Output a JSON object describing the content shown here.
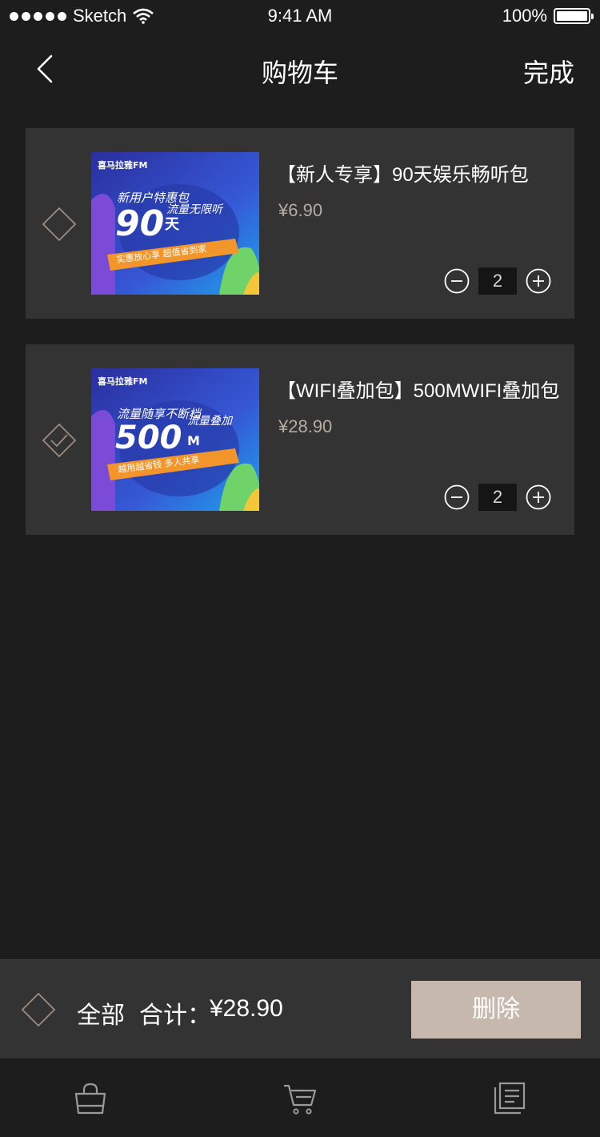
{
  "status_bar": {
    "carrier": "Sketch",
    "time": "9:41 AM",
    "battery": "100%"
  },
  "nav": {
    "title": "购物车",
    "done_label": "完成"
  },
  "items": [
    {
      "title": "【新人专享】90天娱乐畅听包",
      "price": "¥6.90",
      "quantity": "2",
      "checked": false,
      "image": {
        "brand": "喜马拉雅FM",
        "line1": "新用户特惠包",
        "big": "90",
        "unit": "天",
        "tag": "流量无限听",
        "banner": "实惠放心享   超值省到家"
      }
    },
    {
      "title": "【WIFI叠加包】500MWIFI叠加包",
      "price": "¥28.90",
      "quantity": "2",
      "checked": true,
      "image": {
        "brand": "喜马拉雅FM",
        "line1": "流量随享不断档",
        "big": "500",
        "unit": "M",
        "tag": "流量叠加",
        "banner": "越用越省钱   多人共享"
      }
    }
  ],
  "footer": {
    "select_all_label": "全部",
    "total_label": "合计：",
    "total_value": "¥28.90",
    "delete_label": "删除"
  },
  "tabbar": {
    "icons": [
      "shopping-bag-icon",
      "cart-icon",
      "orders-icon"
    ]
  },
  "colors": {
    "background": "#1c1d1c",
    "card": "#323332",
    "accent": "#c7b8ad",
    "price": "#b7aca4",
    "outline": "#9e8c80"
  }
}
